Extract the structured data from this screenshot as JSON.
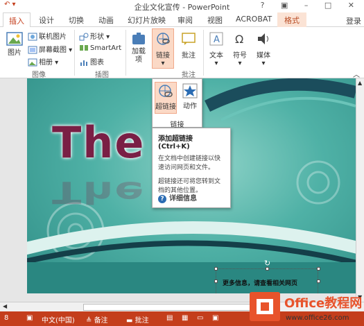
{
  "window": {
    "title": "企业文化宣传 - PowerPoint",
    "help_icon": "?",
    "controls": [
      "restore-icon",
      "minimize-icon",
      "maximize-icon",
      "close-icon"
    ]
  },
  "tabs": [
    "插入",
    "设计",
    "切换",
    "动画",
    "幻灯片放映",
    "审阅",
    "视图",
    "ACROBAT",
    "格式"
  ],
  "active_tab": "插入",
  "contextual_tab": "格式",
  "login_label": "登录",
  "ribbon": {
    "images_group": {
      "label": "图像",
      "picture": "图片",
      "online_picture": "联机图片",
      "screenshot": "屏幕截图",
      "album": "相册"
    },
    "illustrations_group": {
      "label": "插图",
      "shapes": "形状",
      "smartart": "SmartArt",
      "chart": "图表"
    },
    "addins": "加载项",
    "links": "链接",
    "comments_group": {
      "label": "批注",
      "comment": "批注"
    },
    "text": "文本",
    "symbol": "符号",
    "media": "媒体"
  },
  "links_dropdown": {
    "hyperlink": "超链接",
    "action": "动作",
    "group_label": "链接"
  },
  "tooltip": {
    "title": "添加超链接 (Ctrl+K)",
    "p1": "在文档中创建链接以快速访问网页和文件。",
    "p2": "超链接还可将您转到文档的其他位置。",
    "more": "详细信息"
  },
  "slide": {
    "title_text": "The B",
    "selected_text": "更多信息，请查看相关网页"
  },
  "statusbar": {
    "slide_indicator": "8",
    "language": "中文(中国)",
    "notes": "备注",
    "comments": "批注"
  },
  "watermark": {
    "brand": "Office教程网",
    "url": "www.office26.com"
  },
  "colors": {
    "accent": "#c43e1c",
    "slide_title": "#7a1f45",
    "teal": "#4fb1a6"
  }
}
